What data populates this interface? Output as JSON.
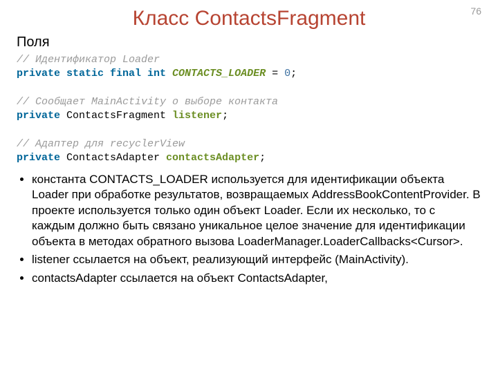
{
  "pageNumber": "76",
  "title": "Класс ContactsFragment",
  "subheading": "Поля",
  "code": {
    "c1": "// Идентификатор Loader",
    "l2_key": "private static final int",
    "l2_ident": " CONTACTS_LOADER",
    "l2_eq": " = ",
    "l2_num": "0",
    "l2_semi": ";",
    "c2": "// Сообщает MainActivity о выборе контакта",
    "l4_key": "private",
    "l4_type": " ContactsFragment ",
    "l4_ident": "listener",
    "l4_semi": ";",
    "c3": "// Адаптер для recyclerView",
    "l6_key": "private",
    "l6_type": " ContactsAdapter ",
    "l6_ident": "contactsAdapter",
    "l6_semi": ";"
  },
  "bullets": [
    "константа CONTACTS_LOADER используется для идентификации объекта Loader при обработке результатов, возвращаемых AddressBookContentProvider. В проекте используется только один объект Loader. Если их несколько, то с каждым должно быть связано уникальное целое значение для идентификации объекта в методах обратного вызова LoaderManager.LoaderCallbacks<Cursor>.",
    "listener ссылается на объект, реализующий интерфейс (MainActivity).",
    "contactsAdapter ссылается на объект ContactsAdapter,"
  ]
}
